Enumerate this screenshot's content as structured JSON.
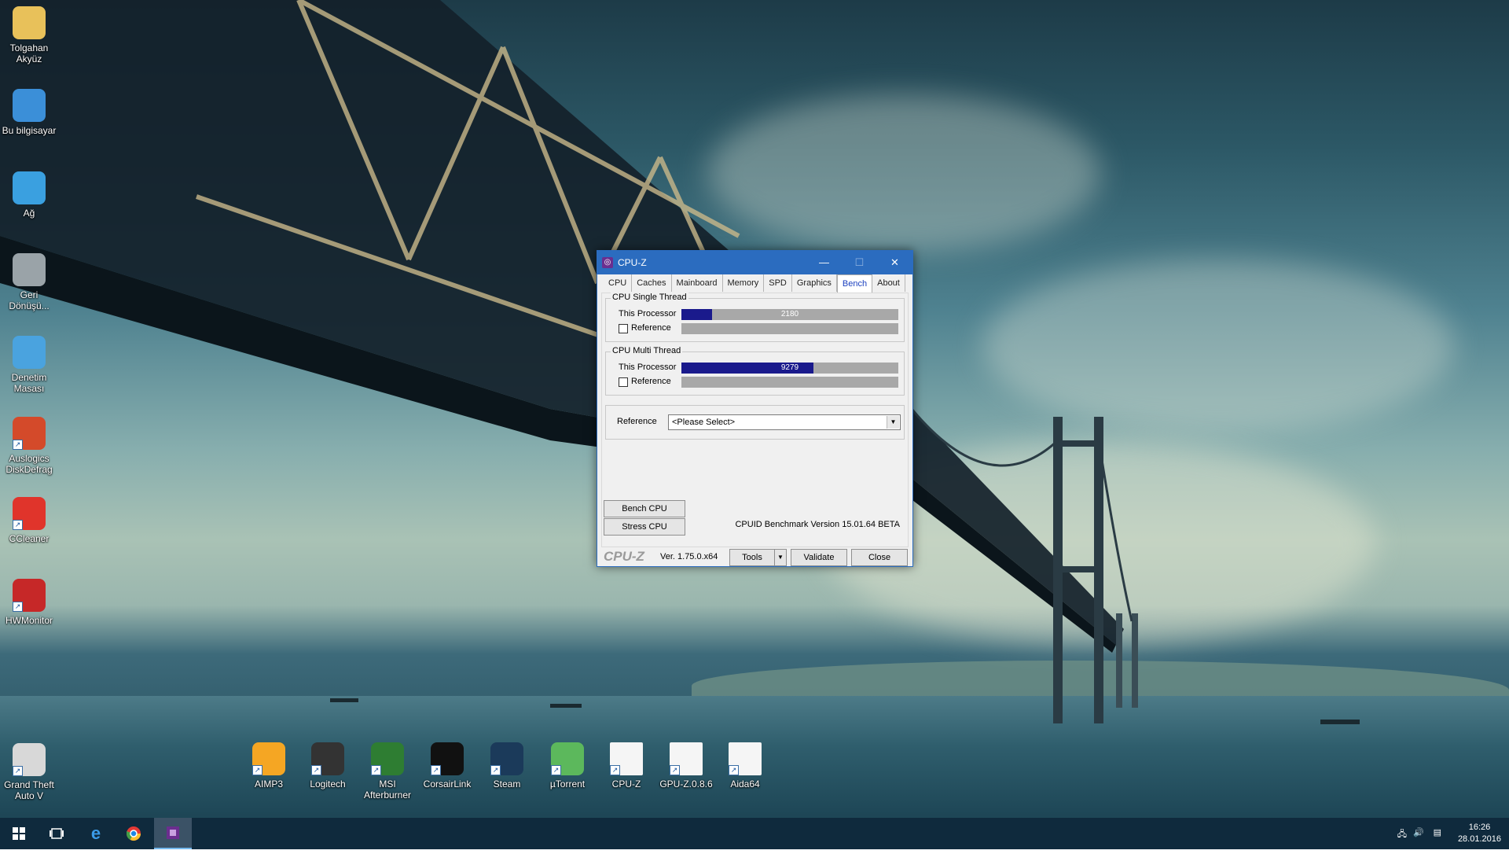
{
  "desktop": {
    "left_icons": [
      {
        "label": "Tolgahan\nAkyüz",
        "icon": "user-folder-icon"
      },
      {
        "label": "Bu bilgisayar",
        "icon": "computer-icon"
      },
      {
        "label": "Ağ",
        "icon": "network-icon"
      },
      {
        "label": "Geri\nDönüşü...",
        "icon": "recycle-bin-icon"
      },
      {
        "label": "Denetim\nMasası",
        "icon": "control-panel-icon"
      },
      {
        "label": "Auslogics\nDiskDefrag",
        "icon": "diskdefrag-icon"
      },
      {
        "label": "CCleaner",
        "icon": "ccleaner-icon"
      },
      {
        "label": "HWMonitor",
        "icon": "hwmonitor-icon"
      },
      {
        "label": "Grand Theft\nAuto V",
        "icon": "gta-v-icon"
      }
    ],
    "bottom_icons": [
      {
        "label": "AIMP3",
        "icon": "aimp-icon"
      },
      {
        "label": "Logitech",
        "icon": "logitech-icon"
      },
      {
        "label": "MSI\nAfterburner",
        "icon": "msi-afterburner-icon"
      },
      {
        "label": "CorsairLink",
        "icon": "corsairlink-icon"
      },
      {
        "label": "Steam",
        "icon": "steam-icon"
      },
      {
        "label": "µTorrent",
        "icon": "utorrent-icon"
      },
      {
        "label": "CPU-Z",
        "icon": "file-icon"
      },
      {
        "label": "GPU-Z.0.8.6",
        "icon": "file-icon"
      },
      {
        "label": "Aida64",
        "icon": "file-icon"
      }
    ]
  },
  "cpuz": {
    "title": "CPU-Z",
    "minimize": "—",
    "maximize": "☐",
    "close": "✕",
    "tabs": [
      "CPU",
      "Caches",
      "Mainboard",
      "Memory",
      "SPD",
      "Graphics",
      "Bench",
      "About"
    ],
    "active_tab": "Bench",
    "single": {
      "legend": "CPU Single Thread",
      "this_label": "This Processor",
      "this_value": "2180",
      "this_fraction": 0.14,
      "ref_label": "Reference"
    },
    "multi": {
      "legend": "CPU Multi Thread",
      "this_label": "This Processor",
      "this_value": "9279",
      "this_fraction": 0.61,
      "ref_label": "Reference"
    },
    "reference": {
      "label": "Reference",
      "selected": "<Please Select>"
    },
    "bench_button": "Bench CPU",
    "stress_button": "Stress CPU",
    "bench_version": "CPUID Benchmark Version 15.01.64 BETA",
    "footer": {
      "logo": "CPU-Z",
      "version": "Ver. 1.75.0.x64",
      "tools": "Tools",
      "validate": "Validate",
      "close": "Close"
    }
  },
  "taskbar": {
    "time": "16:26",
    "date": "28.01.2016"
  }
}
